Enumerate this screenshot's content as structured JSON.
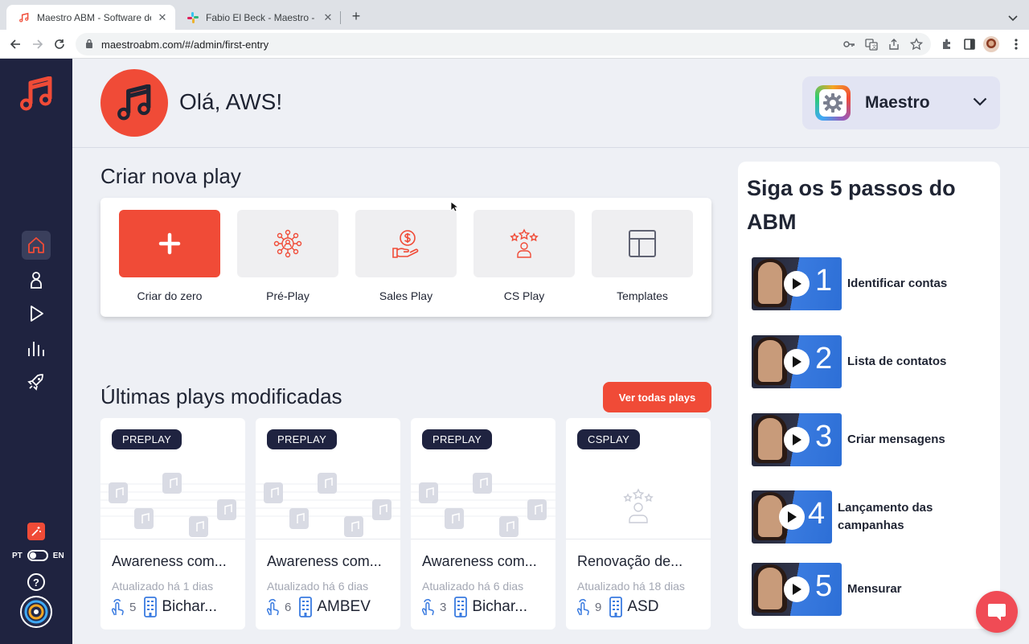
{
  "browser": {
    "tabs": [
      {
        "title": "Maestro ABM - Software de Ac",
        "active": true
      },
      {
        "title": "Fabio El Beck - Maestro - Slac",
        "active": false
      }
    ],
    "new_tab": "+",
    "url": "maestroabm.com/#/admin/first-entry"
  },
  "sidebar": {
    "logo": "maestro-music-logo",
    "items": [
      {
        "name": "home",
        "icon": "home-icon",
        "active": true
      },
      {
        "name": "contacts",
        "icon": "person-icon",
        "active": false
      },
      {
        "name": "plays",
        "icon": "play-icon",
        "active": false
      },
      {
        "name": "analytics",
        "icon": "bar-chart-icon",
        "active": false
      },
      {
        "name": "launch",
        "icon": "rocket-icon",
        "active": false
      }
    ],
    "lang_left": "PT",
    "lang_right": "EN",
    "help": "?"
  },
  "header": {
    "greeting": "Olá, AWS!",
    "org_name": "Maestro"
  },
  "create": {
    "title": "Criar nova play",
    "items": [
      {
        "label": "Criar do zero",
        "icon": "plus-icon"
      },
      {
        "label": "Pré-Play",
        "icon": "network-icon"
      },
      {
        "label": "Sales Play",
        "icon": "money-hand-icon"
      },
      {
        "label": "CS Play",
        "icon": "star-person-icon"
      },
      {
        "label": "Templates",
        "icon": "layout-icon"
      }
    ]
  },
  "recent": {
    "title": "Últimas plays modificadas",
    "see_all": "Ver todas plays",
    "cards": [
      {
        "badge": "PREPLAY",
        "name": "Awareness com...",
        "updated": "Atualizado há 1 dias",
        "count": "5",
        "account": "Bichar..."
      },
      {
        "badge": "PREPLAY",
        "name": "Awareness com...",
        "updated": "Atualizado há 6 dias",
        "count": "6",
        "account": "AMBEV"
      },
      {
        "badge": "PREPLAY",
        "name": "Awareness com...",
        "updated": "Atualizado há 6 dias",
        "count": "3",
        "account": "Bichar..."
      },
      {
        "badge": "CSPLAY",
        "name": "Renovação de...",
        "updated": "Atualizado há 18 dias",
        "count": "9",
        "account": "ASD"
      }
    ]
  },
  "steps": {
    "title": "Siga os 5 passos do ABM",
    "items": [
      {
        "num": "1",
        "label": "Identificar contas"
      },
      {
        "num": "2",
        "label": "Lista de contatos"
      },
      {
        "num": "3",
        "label": "Criar mensagens"
      },
      {
        "num": "4",
        "label": "Lançamento das campanhas"
      },
      {
        "num": "5",
        "label": "Mensurar"
      }
    ]
  },
  "colors": {
    "accent": "#f04b37",
    "sidebar": "#1f2340",
    "badge": "#1f2340"
  }
}
